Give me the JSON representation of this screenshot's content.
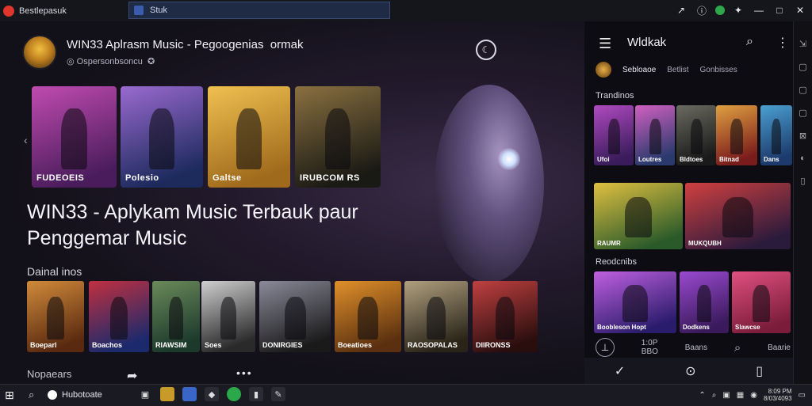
{
  "window": {
    "app_name": "Bestlepasuk",
    "tab_title": "Stuk",
    "controls": {
      "minimize": "—",
      "maximize": "□",
      "close": "✕"
    }
  },
  "main": {
    "profile": {
      "title": "WIN33 Aplrasm Music - Pegoogenias",
      "title_suffix": "ormak",
      "subtitle": "Ospersonbsoncu"
    },
    "featured": [
      {
        "label": "FUDEOEIS",
        "colors": [
          "#4a1c5c",
          "#c04bb0"
        ]
      },
      {
        "label": "Polesio",
        "colors": [
          "#1c2a5c",
          "#9a6ad0"
        ]
      },
      {
        "label": "Galtse",
        "colors": [
          "#a06a1c",
          "#f0c050"
        ]
      },
      {
        "label": "IRUBCOM RS",
        "colors": [
          "#1a1a14",
          "#8a7040"
        ]
      }
    ],
    "hero_title": "WIN33 - Aplykam Music Terbauk paur Penggemar Music",
    "section_title": "Dainal inos",
    "albums": [
      {
        "label": "Boeparl",
        "colors": [
          "#5a2a10",
          "#d08a3a"
        ]
      },
      {
        "label": "Boachos",
        "colors": [
          "#1a2a6c",
          "#c03040"
        ]
      },
      {
        "label": "RIAWSIM",
        "colors": [
          "#1c3a2c",
          "#6a8a5a"
        ]
      },
      {
        "label": "Soes",
        "colors": [
          "#2a2a2a",
          "#cfcfcf"
        ]
      },
      {
        "label": "DONIRGIES",
        "colors": [
          "#1a1a1a",
          "#8a8a9a"
        ]
      },
      {
        "label": "Boeatioes",
        "colors": [
          "#5a3010",
          "#e0902a"
        ]
      },
      {
        "label": "RAOSOPALAS",
        "colors": [
          "#2a2418",
          "#b0a080"
        ]
      },
      {
        "label": "DIIRONSS",
        "colors": [
          "#2a0e0e",
          "#c04040"
        ]
      }
    ],
    "bottom_label": "Nopaears"
  },
  "sidebar": {
    "title": "Wldkak",
    "tabs": {
      "profile": "Sebloaoe",
      "a": "Betlist",
      "b": "Gonbisses"
    },
    "sec1": "Trandinos",
    "sec1_tiles": [
      {
        "label": "Ufoi",
        "colors": [
          "#3a1c5c",
          "#b04ac0"
        ]
      },
      {
        "label": "Loutres",
        "colors": [
          "#2a3a6c",
          "#d060c0"
        ]
      },
      {
        "label": "Bldtoes",
        "colors": [
          "#1a1a1a",
          "#6a6a60"
        ]
      },
      {
        "label": "Bitnad",
        "colors": [
          "#7a1c1c",
          "#e0a040"
        ]
      },
      {
        "label": "Dans",
        "colors": [
          "#1c3a6c",
          "#4aa0d0"
        ]
      }
    ],
    "mid_tiles": [
      {
        "label": "RAUMR",
        "colors": [
          "#2a5a2a",
          "#e0c040"
        ]
      },
      {
        "label": "MUKQUBH",
        "colors": [
          "#2a1a3c",
          "#d04040"
        ]
      }
    ],
    "sec2": "Reodcnibs",
    "sec2_tiles": [
      {
        "label": "Boobleson Hopt",
        "colors": [
          "#2a1c6c",
          "#c060e0"
        ]
      },
      {
        "label": "Dodkens",
        "colors": [
          "#3a1a5c",
          "#9a4ad0"
        ]
      },
      {
        "label": "Slawcse",
        "colors": [
          "#7a1c3a",
          "#e05080"
        ]
      }
    ],
    "controls": {
      "play_label": "1:0P",
      "plays": "BBO",
      "a": "Baans",
      "b": "Baarie"
    }
  },
  "taskbar": {
    "app_label": "Hubotoate",
    "time": "8:09 PM",
    "date": "8/03/4093"
  }
}
